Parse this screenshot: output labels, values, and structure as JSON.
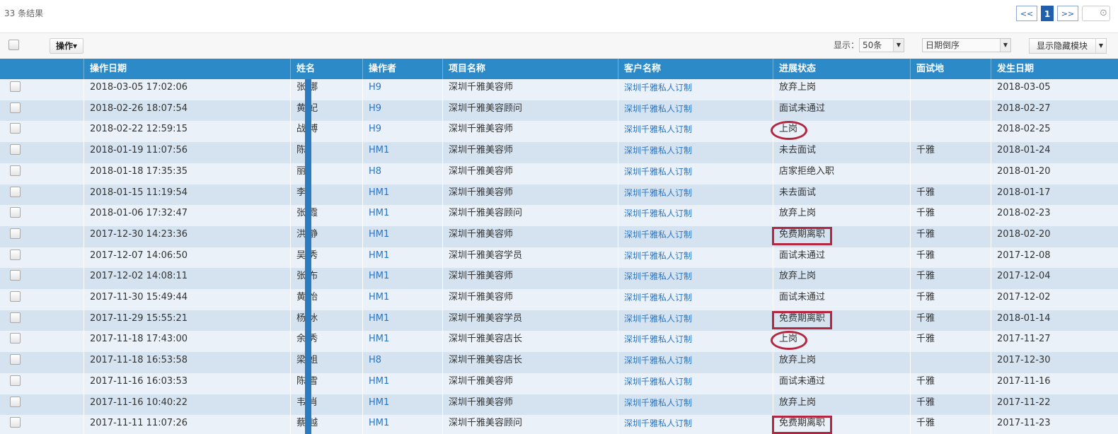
{
  "result_summary": "33 条结果",
  "pagination": {
    "prev": "<<",
    "current": "1",
    "next": ">>"
  },
  "toolbar": {
    "operate_label": "操作▾",
    "display_label": "显示：",
    "page_size": "50条",
    "sort_order": "日期倒序",
    "toggle_modules": "显示隐藏模块"
  },
  "columns": [
    "操作日期",
    "姓名",
    "操作者",
    "项目名称",
    "客户名称",
    "进展状态",
    "面试地",
    "发生日期"
  ],
  "rows": [
    {
      "date": "2018-03-05 17:02:06",
      "name": "张    娜",
      "operator": "H9",
      "project": "深圳千雅美容师",
      "client": "深圳千雅私人订制",
      "status": "放弃上岗",
      "location": "",
      "occur": "2018-03-05",
      "mark": ""
    },
    {
      "date": "2018-02-26 18:07:54",
      "name": "黄    妃",
      "operator": "H9",
      "project": "深圳千雅美容顾问",
      "client": "深圳千雅私人订制",
      "status": "面试未通过",
      "location": "",
      "occur": "2018-02-27",
      "mark": ""
    },
    {
      "date": "2018-02-22 12:59:15",
      "name": "战    博",
      "operator": "H9",
      "project": "深圳千雅美容师",
      "client": "深圳千雅私人订制",
      "status": "上岗",
      "location": "",
      "occur": "2018-02-25",
      "mark": "ellipse"
    },
    {
      "date": "2018-01-19 11:07:56",
      "name": "陈    ",
      "operator": "HM1",
      "project": "深圳千雅美容师",
      "client": "深圳千雅私人订制",
      "status": "未去面试",
      "location": "千雅",
      "occur": "2018-01-24",
      "mark": ""
    },
    {
      "date": "2018-01-18 17:35:35",
      "name": "丽    ",
      "operator": "H8",
      "project": "深圳千雅美容师",
      "client": "深圳千雅私人订制",
      "status": "店家拒绝入职",
      "location": "",
      "occur": "2018-01-20",
      "mark": ""
    },
    {
      "date": "2018-01-15 11:19:54",
      "name": "李    ",
      "operator": "HM1",
      "project": "深圳千雅美容师",
      "client": "深圳千雅私人订制",
      "status": "未去面试",
      "location": "千雅",
      "occur": "2018-01-17",
      "mark": ""
    },
    {
      "date": "2018-01-06 17:32:47",
      "name": "张    霞",
      "operator": "HM1",
      "project": "深圳千雅美容顾问",
      "client": "深圳千雅私人订制",
      "status": "放弃上岗",
      "location": "千雅",
      "occur": "2018-02-23",
      "mark": ""
    },
    {
      "date": "2017-12-30 14:23:36",
      "name": "洪    静",
      "operator": "HM1",
      "project": "深圳千雅美容师",
      "client": "深圳千雅私人订制",
      "status": "免费期离职",
      "location": "千雅",
      "occur": "2018-02-20",
      "mark": "rect"
    },
    {
      "date": "2017-12-07 14:06:50",
      "name": "吴    秀",
      "operator": "HM1",
      "project": "深圳千雅美容学员",
      "client": "深圳千雅私人订制",
      "status": "面试未通过",
      "location": "千雅",
      "occur": "2017-12-08",
      "mark": ""
    },
    {
      "date": "2017-12-02 14:08:11",
      "name": "张    布",
      "operator": "HM1",
      "project": "深圳千雅美容师",
      "client": "深圳千雅私人订制",
      "status": "放弃上岗",
      "location": "千雅",
      "occur": "2017-12-04",
      "mark": ""
    },
    {
      "date": "2017-11-30 15:49:44",
      "name": "黄    怡",
      "operator": "HM1",
      "project": "深圳千雅美容师",
      "client": "深圳千雅私人订制",
      "status": "面试未通过",
      "location": "千雅",
      "occur": "2017-12-02",
      "mark": ""
    },
    {
      "date": "2017-11-29 15:55:21",
      "name": "杨    冰",
      "operator": "HM1",
      "project": "深圳千雅美容学员",
      "client": "深圳千雅私人订制",
      "status": "免费期离职",
      "location": "千雅",
      "occur": "2018-01-14",
      "mark": "rect"
    },
    {
      "date": "2017-11-18 17:43:00",
      "name": "余    秀",
      "operator": "HM1",
      "project": "深圳千雅美容店长",
      "client": "深圳千雅私人订制",
      "status": "上岗",
      "location": "千雅",
      "occur": "2017-11-27",
      "mark": "ellipse"
    },
    {
      "date": "2017-11-18 16:53:58",
      "name": "梁    姐",
      "operator": "H8",
      "project": "深圳千雅美容店长",
      "client": "深圳千雅私人订制",
      "status": "放弃上岗",
      "location": "",
      "occur": "2017-12-30",
      "mark": ""
    },
    {
      "date": "2017-11-16 16:03:53",
      "name": "陈    雪",
      "operator": "HM1",
      "project": "深圳千雅美容师",
      "client": "深圳千雅私人订制",
      "status": "面试未通过",
      "location": "千雅",
      "occur": "2017-11-16",
      "mark": ""
    },
    {
      "date": "2017-11-16 10:40:22",
      "name": "韦    肖",
      "operator": "HM1",
      "project": "深圳千雅美容师",
      "client": "深圳千雅私人订制",
      "status": "放弃上岗",
      "location": "千雅",
      "occur": "2017-11-22",
      "mark": ""
    },
    {
      "date": "2017-11-11 11:07:26",
      "name": "蔡    越",
      "operator": "HM1",
      "project": "深圳千雅美容顾问",
      "client": "深圳千雅私人订制",
      "status": "免费期离职",
      "location": "千雅",
      "occur": "2017-11-23",
      "mark": "rect"
    }
  ],
  "colors": {
    "header_bg": "#2d8ac9",
    "row_light": "#eaf1f8",
    "row_dark": "#d5e3f0",
    "link": "#2a74c2",
    "annotation": "#b52740"
  }
}
